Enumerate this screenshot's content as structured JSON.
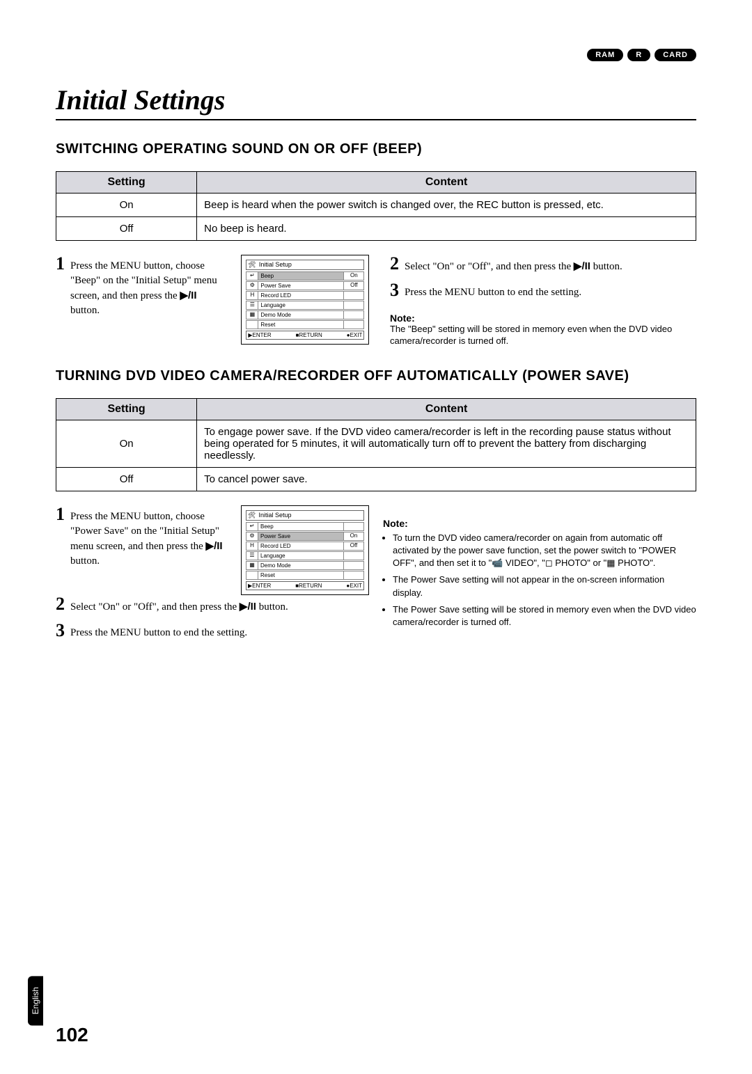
{
  "badges": [
    "RAM",
    "R",
    "CARD"
  ],
  "title": "Initial Settings",
  "section1": {
    "heading": "SWITCHING OPERATING SOUND ON OR OFF (BEEP)",
    "table": {
      "headers": [
        "Setting",
        "Content"
      ],
      "rows": [
        {
          "setting": "On",
          "content": "Beep is heard when the power switch is changed over, the REC button is pressed, etc."
        },
        {
          "setting": "Off",
          "content": "No beep is heard."
        }
      ]
    },
    "steps_left": {
      "num": "1",
      "text_a": "Press the MENU button, choose \"Beep\" on the \"Initial Setup\" menu screen, and then press the",
      "text_b": " button."
    },
    "playpause": "▶/II",
    "menu": {
      "title_icon": "🛠",
      "title": "Initial Setup",
      "rows": [
        {
          "icon": "↵",
          "label": "Beep",
          "value": "On",
          "highlight": true
        },
        {
          "icon": "⚙",
          "label": "Power Save",
          "value": "Off"
        },
        {
          "icon": "H",
          "label": "Record LED",
          "value": ""
        },
        {
          "icon": "☰",
          "label": "Language",
          "value": ""
        },
        {
          "icon": "▦",
          "label": "Demo Mode",
          "value": ""
        },
        {
          "icon": "",
          "label": "Reset",
          "value": ""
        }
      ],
      "footer_left": "▶ENTER",
      "footer_mid": "■RETURN",
      "footer_right": "●EXIT"
    },
    "steps_right": [
      {
        "num": "2",
        "text_a": "Select \"On\" or \"Off\", and then press the",
        "text_b": " button."
      },
      {
        "num": "3",
        "text_a": "Press the MENU button to end the setting.",
        "text_b": ""
      }
    ],
    "note_heading": "Note:",
    "note_text": "The \"Beep\" setting will be stored in memory even when the DVD video camera/recorder is turned off."
  },
  "section2": {
    "heading": "TURNING DVD VIDEO CAMERA/RECORDER OFF AUTOMATICALLY (POWER SAVE)",
    "table": {
      "headers": [
        "Setting",
        "Content"
      ],
      "rows": [
        {
          "setting": "On",
          "content": "To engage power save. If the DVD video camera/recorder is left in the recording pause status without being operated for 5 minutes, it will automatically turn off to prevent the battery from discharging needlessly."
        },
        {
          "setting": "Off",
          "content": "To cancel power save."
        }
      ]
    },
    "steps_left": [
      {
        "num": "1",
        "text_a": "Press the MENU button, choose \"Power Save\" on the \"Initial Setup\" menu screen, and then press the",
        "text_b": " button."
      },
      {
        "num": "2",
        "text_a": "Select \"On\" or \"Off\", and then press the",
        "text_b": " button."
      },
      {
        "num": "3",
        "text_a": "Press the MENU button to end the setting.",
        "text_b": ""
      }
    ],
    "menu": {
      "title_icon": "🛠",
      "title": "Initial Setup",
      "rows": [
        {
          "icon": "↵",
          "label": "Beep",
          "value": ""
        },
        {
          "icon": "⚙",
          "label": "Power Save",
          "value": "On",
          "highlight": true
        },
        {
          "icon": "H",
          "label": "Record LED",
          "value": "Off"
        },
        {
          "icon": "☰",
          "label": "Language",
          "value": ""
        },
        {
          "icon": "▦",
          "label": "Demo Mode",
          "value": ""
        },
        {
          "icon": "",
          "label": "Reset",
          "value": ""
        }
      ],
      "footer_left": "▶ENTER",
      "footer_mid": "■RETURN",
      "footer_right": "●EXIT"
    },
    "note_heading": "Note:",
    "notes": [
      "To turn the DVD video camera/recorder on again from automatic off activated by the power save function, set the power switch to \"POWER OFF\", and then set it to \"📹 VIDEO\", \"◻ PHOTO\" or \"▦ PHOTO\".",
      "The Power Save setting will not appear in the on-screen information display.",
      "The Power Save setting will be stored in memory even when the DVD video camera/recorder is turned off."
    ]
  },
  "lang_tab": "English",
  "page_number": "102"
}
